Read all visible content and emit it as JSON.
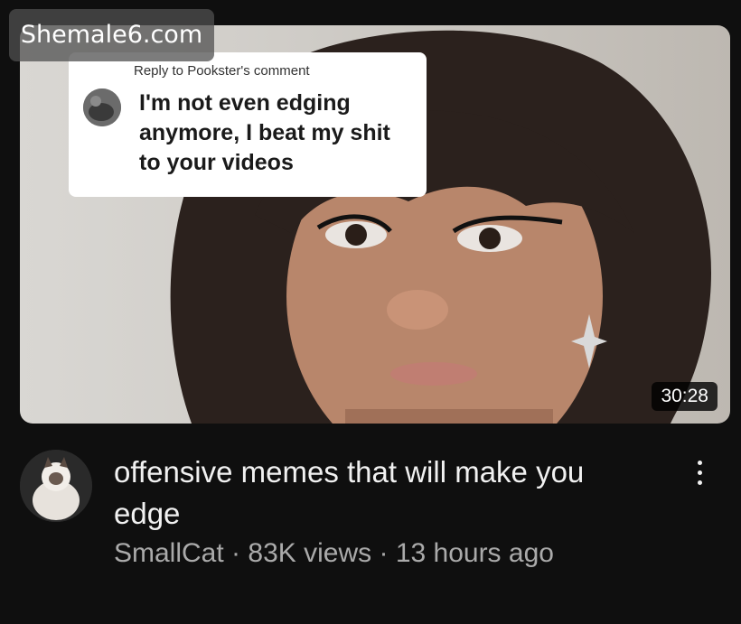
{
  "watermark": "Shemale6.com",
  "thumbnail": {
    "comment_header": "Reply to Pookster's comment",
    "comment_text": "I'm not even edging anymore, I beat my shit to your videos",
    "duration": "30:28"
  },
  "video": {
    "title": "offensive memes that will make you edge",
    "channel": "SmallCat",
    "views": "83K views",
    "age": "13 hours ago",
    "separator": "·"
  },
  "icons": {
    "more": "more-vert-icon"
  }
}
